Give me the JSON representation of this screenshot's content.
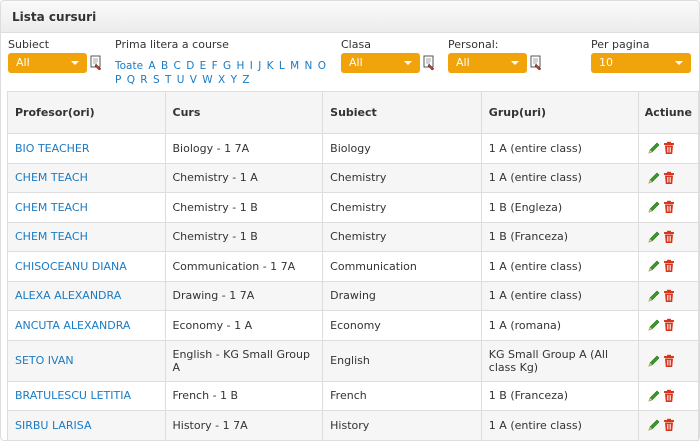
{
  "panel": {
    "title": "Lista cursuri"
  },
  "filters": {
    "subiect": {
      "label": "Subiect",
      "value": "All"
    },
    "letter": {
      "label": "Prima litera a course",
      "items": [
        "Toate",
        "A",
        "B",
        "C",
        "D",
        "E",
        "F",
        "G",
        "H",
        "I",
        "J",
        "K",
        "L",
        "M",
        "N",
        "O",
        "P",
        "Q",
        "R",
        "S",
        "T",
        "U",
        "V",
        "W",
        "X",
        "Y",
        "Z"
      ]
    },
    "clasa": {
      "label": "Clasa",
      "value": "All"
    },
    "personal": {
      "label": "Personal:",
      "value": "All"
    },
    "per_pagina": {
      "label": "Per pagina",
      "value": "10"
    }
  },
  "table": {
    "headers": {
      "profesor": "Profesor(ori)",
      "curs": "Curs",
      "subiect": "Subiect",
      "grup": "Grup(uri)",
      "actiune": "Actiune"
    },
    "rows": [
      {
        "profesor": "BIO TEACHER",
        "curs": "Biology - 1 7A",
        "subiect": "Biology",
        "grup": "1 A (entire class)"
      },
      {
        "profesor": "CHEM TEACH",
        "curs": "Chemistry - 1 A",
        "subiect": "Chemistry",
        "grup": "1 A (entire class)"
      },
      {
        "profesor": "CHEM TEACH",
        "curs": "Chemistry - 1 B",
        "subiect": "Chemistry",
        "grup": "1 B (Engleza)"
      },
      {
        "profesor": "CHEM TEACH",
        "curs": "Chemistry - 1 B",
        "subiect": "Chemistry",
        "grup": "1 B (Franceza)"
      },
      {
        "profesor": "CHISOCEANU DIANA",
        "curs": "Communication - 1 7A",
        "subiect": "Communication",
        "grup": "1 A (entire class)"
      },
      {
        "profesor": "ALEXA ALEXANDRA",
        "curs": "Drawing - 1 7A",
        "subiect": "Drawing",
        "grup": "1 A (entire class)"
      },
      {
        "profesor": "ANCUTA ALEXANDRA",
        "curs": "Economy - 1 A",
        "subiect": "Economy",
        "grup": "1 A (romana)"
      },
      {
        "profesor": "SETO IVAN",
        "curs": "English - KG Small Group A",
        "subiect": "English",
        "grup": "KG Small Group A (All class Kg)"
      },
      {
        "profesor": "BRATULESCU LETITIA",
        "curs": "French - 1 B",
        "subiect": "French",
        "grup": "1 B (Franceza)"
      },
      {
        "profesor": "SIRBU LARISA",
        "curs": "History - 1 7A",
        "subiect": "History",
        "grup": "1 A (entire class)"
      }
    ]
  },
  "icons": {
    "edit": "pencil-icon",
    "delete": "trash-icon",
    "clear": "eraser-icon"
  },
  "colors": {
    "accent": "#f0a30a",
    "link": "#1a7bc4",
    "edit": "#3a9a2a",
    "delete": "#d9341c"
  }
}
